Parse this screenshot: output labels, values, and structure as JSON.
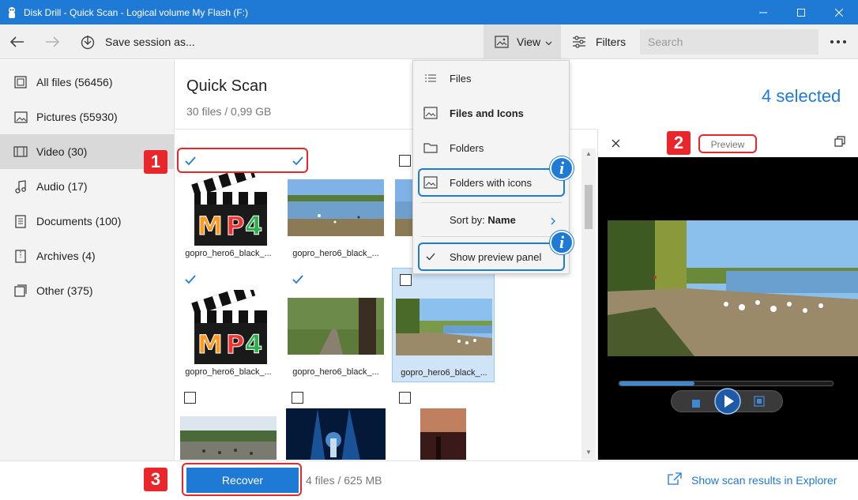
{
  "window": {
    "title": "Disk Drill - Quick Scan - Logical volume My Flash (F:)"
  },
  "toolbar": {
    "save_session_label": "Save session as...",
    "view_label": "View",
    "filters_label": "Filters",
    "search_placeholder": "Search"
  },
  "sidebar": {
    "items": [
      {
        "label": "All files (56456)",
        "icon": "all-files-icon"
      },
      {
        "label": "Pictures (55930)",
        "icon": "picture-icon"
      },
      {
        "label": "Video (30)",
        "icon": "video-icon",
        "active": true
      },
      {
        "label": "Audio (17)",
        "icon": "audio-icon"
      },
      {
        "label": "Documents (100)",
        "icon": "document-icon"
      },
      {
        "label": "Archives (4)",
        "icon": "archive-icon"
      },
      {
        "label": "Other (375)",
        "icon": "other-icon"
      }
    ]
  },
  "main": {
    "title": "Quick Scan",
    "subtitle": "30 files / 0,99 GB",
    "selected_count": "4 selected"
  },
  "grid": {
    "tiles": [
      {
        "name": "gopro_hero6_black_...",
        "checked": true,
        "thumb": "mp4-logo"
      },
      {
        "name": "gopro_hero6_black_...",
        "checked": true,
        "thumb": "lake"
      },
      {
        "name": "",
        "checked": false,
        "thumb": "lake-partial"
      },
      {
        "name": "gopro_hero6_black_...",
        "checked": true,
        "thumb": "mp4-logo"
      },
      {
        "name": "gopro_hero6_black_...",
        "checked": true,
        "thumb": "park-tree"
      },
      {
        "name": "gopro_hero6_black_...",
        "checked": false,
        "thumb": "park-path",
        "selected": true
      },
      {
        "name": "",
        "checked": false,
        "thumb": "birds-field"
      },
      {
        "name": "",
        "checked": false,
        "thumb": "concert"
      },
      {
        "name": "",
        "checked": false,
        "thumb": "sunset"
      }
    ]
  },
  "view_menu": {
    "items": {
      "files": "Files",
      "files_and_icons": "Files and Icons",
      "folders": "Folders",
      "folders_with_icons": "Folders with icons",
      "sort_by": "Sort by:",
      "sort_by_value": "Name",
      "show_preview_panel": "Show preview panel"
    },
    "info_badge": "i"
  },
  "preview": {
    "label": "Preview",
    "progress": 0.35
  },
  "bottom": {
    "recover_label": "Recover",
    "info": "4 files / 625 MB",
    "explorer_link": "Show scan results in Explorer"
  },
  "annotations": {
    "badge_1": "1",
    "badge_2": "2",
    "badge_3": "3"
  },
  "colors": {
    "accent": "#1f7ad6",
    "annotation_red": "#e8262b"
  }
}
